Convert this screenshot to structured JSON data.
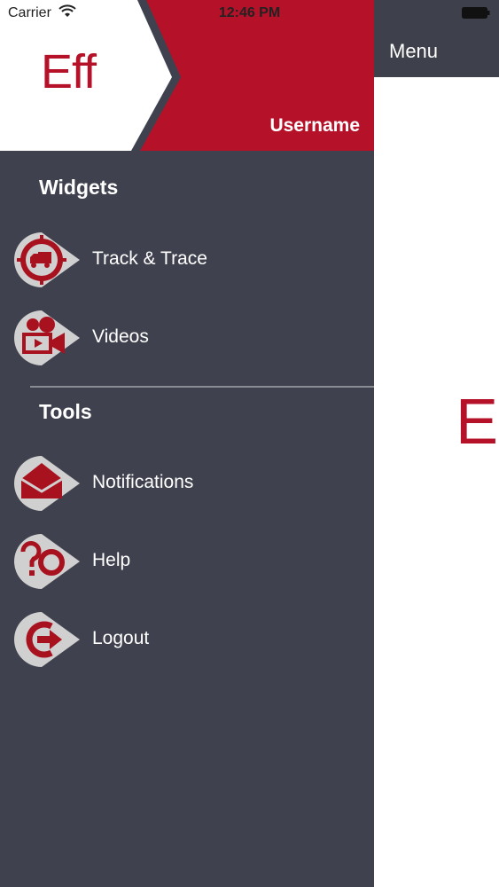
{
  "status_bar": {
    "carrier": "Carrier",
    "time": "12:46 PM"
  },
  "main": {
    "header_title": "Menu",
    "logo_peek": "E"
  },
  "drawer": {
    "logo": "Eff",
    "username": "Username",
    "sections": [
      {
        "title": "Widgets",
        "items": [
          {
            "label": "Track & Trace",
            "icon": "truck-target-icon"
          },
          {
            "label": "Videos",
            "icon": "video-camera-icon"
          }
        ]
      },
      {
        "title": "Tools",
        "items": [
          {
            "label": "Notifications",
            "icon": "envelope-icon"
          },
          {
            "label": "Help",
            "icon": "lifebuoy-question-icon"
          },
          {
            "label": "Logout",
            "icon": "logout-arrow-icon"
          }
        ]
      }
    ]
  },
  "colors": {
    "accent": "#b5122a",
    "drawer_bg": "#3f424e",
    "header_bg": "#3e414c",
    "icon_bg": "#d1d0d0"
  }
}
